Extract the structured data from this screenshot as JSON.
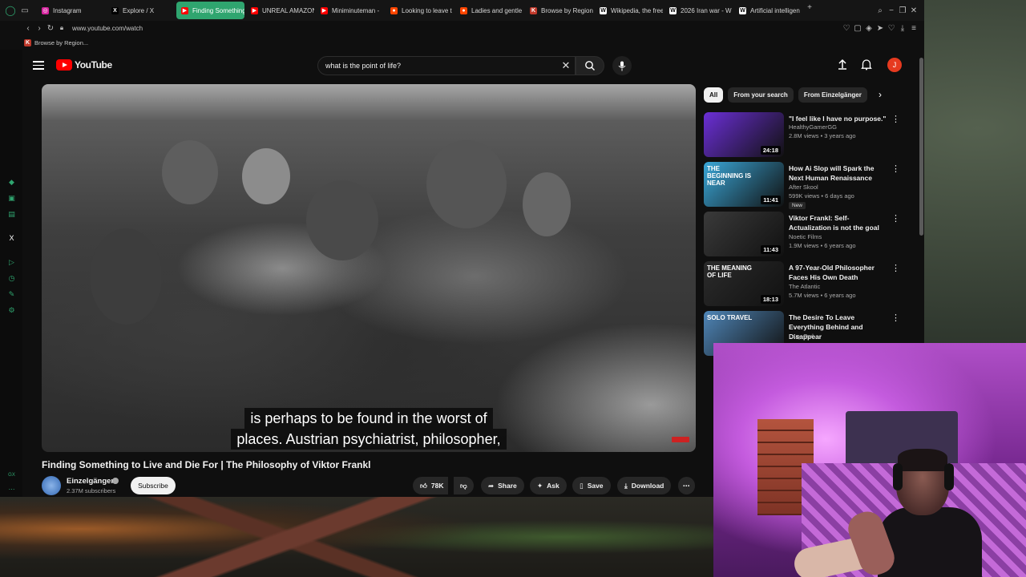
{
  "browser": {
    "tabs": [
      {
        "label": "Instagram",
        "color": "#d6249f",
        "glyph": "◎"
      },
      {
        "label": "Explore / X",
        "color": "#000000",
        "glyph": "X"
      },
      {
        "label": "Finding Something to",
        "color": "#ff0000",
        "glyph": "▶",
        "active": true
      },
      {
        "label": "UNREAL AMAZON",
        "color": "#ff0000",
        "glyph": "▶"
      },
      {
        "label": "Miniminuteman - ",
        "color": "#ff0000",
        "glyph": "▶"
      },
      {
        "label": "Looking to leave t",
        "color": "#ff4500",
        "glyph": "●"
      },
      {
        "label": "Ladies and gentle",
        "color": "#ff4500",
        "glyph": "●"
      },
      {
        "label": "Browse by Region",
        "color": "#c0392b",
        "glyph": "K"
      },
      {
        "label": "Wikipedia, the free",
        "color": "#ffffff",
        "glyph": "W"
      },
      {
        "label": "2026 Iran war - W",
        "color": "#ffffff",
        "glyph": "W"
      },
      {
        "label": "Artificial intelligen",
        "color": "#ffffff",
        "glyph": "W"
      }
    ],
    "url": "www.youtube.com/watch",
    "bookmark": "Browse by Region..."
  },
  "youtube": {
    "logo_text": "YouTube",
    "search_value": "what is the point of life?",
    "avatar_letter": "J",
    "captions": [
      "is perhaps to be found in the worst of",
      "places. Austrian psychiatrist, philosopher,"
    ],
    "video_title": "Finding Something to Live and Die For | The Philosophy of Viktor Frankl",
    "channel": {
      "name": "Einzelgänger",
      "subscribers": "2.37M subscribers"
    },
    "subscribe_label": "Subscribe",
    "actions": {
      "likes": "78K",
      "share": "Share",
      "ask": "Ask",
      "save": "Save",
      "download": "Download"
    },
    "chips": [
      "All",
      "From your search",
      "From Einzelgänger"
    ],
    "recommendations": [
      {
        "title": "\"I feel like I have no purpose.\"",
        "channel": "HealthyGamerGG",
        "meta": "2.8M views • 3 years ago",
        "duration": "24:18",
        "thumb": "#6b2fd6"
      },
      {
        "title": "How Ai Slop will Spark the Next Human Renaissance",
        "channel": "After Skool",
        "meta": "599K views • 6 days ago",
        "duration": "11:41",
        "thumb": "#3aa7d8",
        "badge": "New",
        "thumb_text": "THE BEGINNING IS NEAR"
      },
      {
        "title": "Viktor Frankl: Self-Actualization is not the goal",
        "channel": "Noetic Films",
        "meta": "1.9M views • 6 years ago",
        "duration": "11:43",
        "thumb": "#3a3a3a"
      },
      {
        "title": "A 97-Year-Old Philosopher Faces His Own Death",
        "channel": "The Atlantic",
        "meta": "5.7M views • 6 years ago",
        "duration": "18:13",
        "thumb": "#2b2b2b",
        "thumb_text": "THE MEANING OF LIFE"
      },
      {
        "title": "The Desire To Leave Everything Behind and Disappear",
        "channel": "Lazy Owl",
        "meta": "",
        "duration": "",
        "thumb": "#4f86b8",
        "thumb_text": "SOLO TRAVEL"
      }
    ]
  }
}
